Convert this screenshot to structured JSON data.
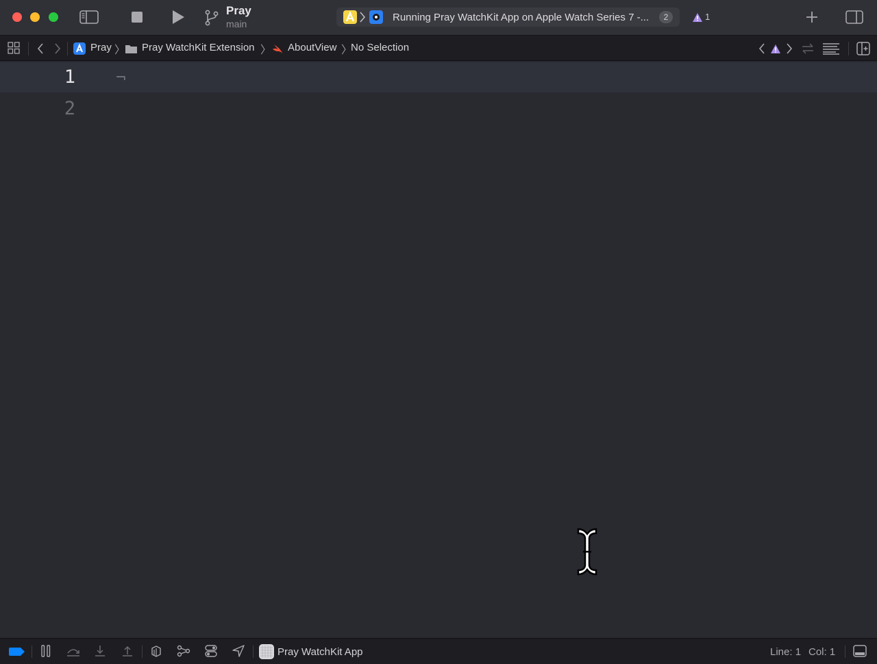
{
  "window": {
    "controls": [
      "close",
      "minimize",
      "zoom"
    ]
  },
  "toolbar": {
    "scheme": {
      "name": "Pray",
      "branch": "main"
    },
    "activity": {
      "status": "Running Pray WatchKit App on Apple Watch Series 7 -...",
      "issues_badge": "2"
    },
    "warnings_count": "1",
    "icons": [
      "sidebar-toggle-icon",
      "stop-icon",
      "run-icon",
      "branch-icon",
      "plus-icon",
      "inspector-toggle-icon"
    ]
  },
  "jumpbar": {
    "crumbs": [
      {
        "label": "Pray",
        "icon": "app-project-icon"
      },
      {
        "label": "Pray WatchKit Extension",
        "icon": "folder-icon"
      },
      {
        "label": "AboutView",
        "icon": "swift-file-icon"
      },
      {
        "label": "No Selection",
        "icon": ""
      }
    ]
  },
  "editor": {
    "line_numbers": [
      "1",
      "2"
    ],
    "current_line": "1",
    "invisible_char": "¬"
  },
  "statusbar": {
    "target": "Pray WatchKit App",
    "line_label": "Line: 1",
    "col_label": "Col: 1"
  },
  "colors": {
    "editor_bg": "#292a30",
    "current_line_bg": "#2f323b",
    "accent_blue": "#0a84ff",
    "warning_purple": "#a88ee8"
  }
}
